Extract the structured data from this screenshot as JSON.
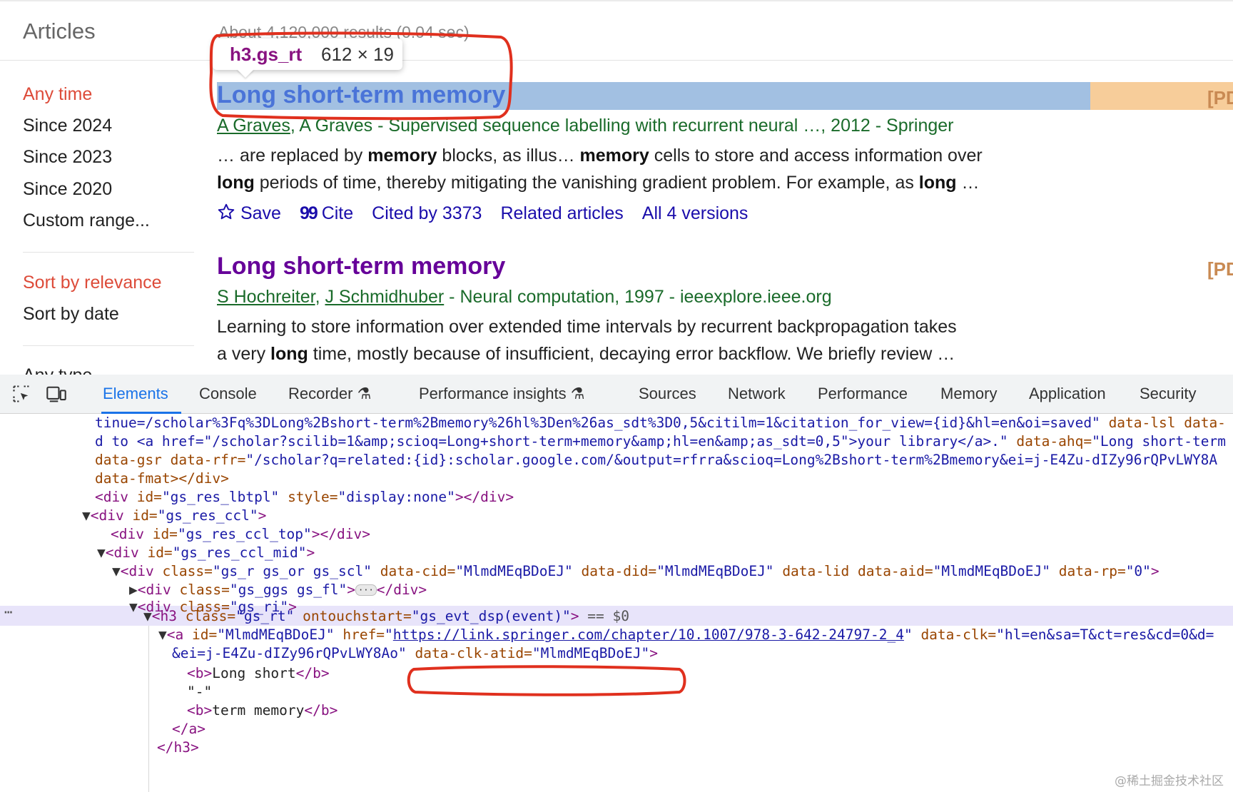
{
  "scholar": {
    "section_title": "Articles",
    "results_count": "About 4,120,000 results (0.04 sec)",
    "sidebar": {
      "time_filters": [
        "Any time",
        "Since 2024",
        "Since 2023",
        "Since 2020",
        "Custom range..."
      ],
      "active_time_filter": "Any time",
      "sort_options": [
        "Sort by relevance",
        "Sort by date"
      ],
      "active_sort": "Sort by relevance",
      "type_label": "Any type"
    },
    "results": [
      {
        "title": "Long short-term memory",
        "pdf_tag": "[PDF]",
        "authors": [
          "A Graves",
          "A Graves"
        ],
        "meta_rest": "- Supervised sequence labelling with recurrent neural …, 2012 - Springer",
        "snippet_line1": [
          "… are replaced by ",
          "memory",
          " blocks, as illus… ",
          "memory",
          " cells to store and access information over"
        ],
        "snippet_line2": [
          "long",
          " periods of time, thereby mitigating the vanishing gradient problem. For example, as ",
          "long",
          " …"
        ],
        "actions": {
          "save": "Save",
          "cite": "Cite",
          "cited_by": "Cited by 3373",
          "related": "Related articles",
          "versions": "All 4 versions"
        }
      },
      {
        "title": "Long short-term memory",
        "pdf_tag": "[PDF]",
        "authors": [
          "S Hochreiter",
          "J Schmidhuber"
        ],
        "meta_rest": "- Neural computation, 1997 - ieeexplore.ieee.org",
        "snippet_line1": [
          "Learning to store information over extended time intervals by recurrent backpropagation takes"
        ],
        "snippet_line2": [
          "a very ",
          "long",
          " time, mostly because of insufficient, decaying error backflow. We briefly review …"
        ]
      }
    ]
  },
  "inspector_tooltip": {
    "tag": "h3.gs_rt",
    "dims": "612 × 19"
  },
  "devtools": {
    "tabs": [
      "Elements",
      "Console",
      "Recorder",
      "Performance insights",
      "Sources",
      "Network",
      "Performance",
      "Memory",
      "Application",
      "Security"
    ],
    "active_tab": "Elements",
    "dom_lines": {
      "l1": "tinue=/scholar%3Fq%3DLong%2Bshort-term%2Bmemory%26hl%3Den%26as_sdt%3D0,5&citilm=1&citation_for_view={id}&hl=en&oi=saved\"",
      "l1_attr": "data-lsl data-",
      "l2a": "d to <a href=\"/scholar?scilib=1&amp;scioq=Long+short-term+memory&amp;hl=en&amp;as_sdt=0,5\">your library</a>.\"",
      "l2_attr": "data-ahq=",
      "l2_val": "\"Long short-term",
      "l3_attr": "data-gsr data-rfr=",
      "l3_val": "\"/scholar?q=related:{id}:scholar.google.com/&output=rfrra&scioq=Long%2Bshort-term%2Bmemory&ei=j-E4Zu-dIZy96rQPvLWY8A",
      "l4": "data-fmat></div>",
      "lbtpl_id": "\"gs_res_lbtpl\"",
      "lbtpl_style": "\"display:none\"",
      "ccl_id": "\"gs_res_ccl\"",
      "ccl_top_id": "\"gs_res_ccl_top\"",
      "ccl_mid_id": "\"gs_res_ccl_mid\"",
      "gs_r_class": "\"gs_r gs_or gs_scl\"",
      "cid": "\"MlmdMEqBDoEJ\"",
      "did": "\"MlmdMEqBDoEJ\"",
      "aid": "\"MlmdMEqBDoEJ\"",
      "rp": "\"0\"",
      "ggs_class": "\"gs_ggs gs_fl\"",
      "ri_class": "\"gs_ri\"",
      "h3_class": "\"gs_rt\"",
      "h3_touch": "\"gs_evt_dsp(event)\"",
      "eq0": "== $0",
      "a_id": "\"MlmdMEqBDoEJ\"",
      "a_href": "https://link.springer.com/chapter/10.1007/978-3-642-24797-2_4",
      "a_clk": "\"hl=en&sa=T&ct=res&cd=0&d=",
      "a_ei": "&ei=j-E4Zu-dIZy96rQPvLWY8Ao\"",
      "a_atid": "\"MlmdMEqBDoEJ\"",
      "b1_text": "Long short",
      "dash": "\"-\"",
      "b2_text": "term memory"
    }
  },
  "watermark": "@稀土掘金技术社区",
  "colors": {
    "highlight_blue": "#a2c0e2",
    "highlight_orange": "#f7cd9a",
    "annotation_red": "#e0301e",
    "visited_title": "#660099",
    "link_blue": "#1a0dab",
    "meta_green": "#1a6b2a",
    "active_sidebar": "#dd4b39"
  }
}
